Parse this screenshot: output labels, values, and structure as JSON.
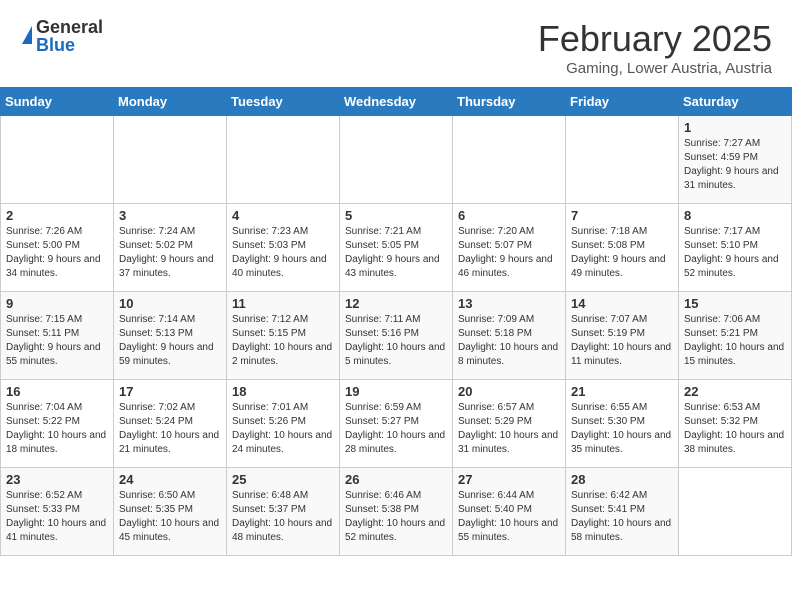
{
  "header": {
    "logo_general": "General",
    "logo_blue": "Blue",
    "month_title": "February 2025",
    "location": "Gaming, Lower Austria, Austria"
  },
  "days_of_week": [
    "Sunday",
    "Monday",
    "Tuesday",
    "Wednesday",
    "Thursday",
    "Friday",
    "Saturday"
  ],
  "weeks": [
    [
      {
        "day": "",
        "info": ""
      },
      {
        "day": "",
        "info": ""
      },
      {
        "day": "",
        "info": ""
      },
      {
        "day": "",
        "info": ""
      },
      {
        "day": "",
        "info": ""
      },
      {
        "day": "",
        "info": ""
      },
      {
        "day": "1",
        "info": "Sunrise: 7:27 AM\nSunset: 4:59 PM\nDaylight: 9 hours and 31 minutes."
      }
    ],
    [
      {
        "day": "2",
        "info": "Sunrise: 7:26 AM\nSunset: 5:00 PM\nDaylight: 9 hours and 34 minutes."
      },
      {
        "day": "3",
        "info": "Sunrise: 7:24 AM\nSunset: 5:02 PM\nDaylight: 9 hours and 37 minutes."
      },
      {
        "day": "4",
        "info": "Sunrise: 7:23 AM\nSunset: 5:03 PM\nDaylight: 9 hours and 40 minutes."
      },
      {
        "day": "5",
        "info": "Sunrise: 7:21 AM\nSunset: 5:05 PM\nDaylight: 9 hours and 43 minutes."
      },
      {
        "day": "6",
        "info": "Sunrise: 7:20 AM\nSunset: 5:07 PM\nDaylight: 9 hours and 46 minutes."
      },
      {
        "day": "7",
        "info": "Sunrise: 7:18 AM\nSunset: 5:08 PM\nDaylight: 9 hours and 49 minutes."
      },
      {
        "day": "8",
        "info": "Sunrise: 7:17 AM\nSunset: 5:10 PM\nDaylight: 9 hours and 52 minutes."
      }
    ],
    [
      {
        "day": "9",
        "info": "Sunrise: 7:15 AM\nSunset: 5:11 PM\nDaylight: 9 hours and 55 minutes."
      },
      {
        "day": "10",
        "info": "Sunrise: 7:14 AM\nSunset: 5:13 PM\nDaylight: 9 hours and 59 minutes."
      },
      {
        "day": "11",
        "info": "Sunrise: 7:12 AM\nSunset: 5:15 PM\nDaylight: 10 hours and 2 minutes."
      },
      {
        "day": "12",
        "info": "Sunrise: 7:11 AM\nSunset: 5:16 PM\nDaylight: 10 hours and 5 minutes."
      },
      {
        "day": "13",
        "info": "Sunrise: 7:09 AM\nSunset: 5:18 PM\nDaylight: 10 hours and 8 minutes."
      },
      {
        "day": "14",
        "info": "Sunrise: 7:07 AM\nSunset: 5:19 PM\nDaylight: 10 hours and 11 minutes."
      },
      {
        "day": "15",
        "info": "Sunrise: 7:06 AM\nSunset: 5:21 PM\nDaylight: 10 hours and 15 minutes."
      }
    ],
    [
      {
        "day": "16",
        "info": "Sunrise: 7:04 AM\nSunset: 5:22 PM\nDaylight: 10 hours and 18 minutes."
      },
      {
        "day": "17",
        "info": "Sunrise: 7:02 AM\nSunset: 5:24 PM\nDaylight: 10 hours and 21 minutes."
      },
      {
        "day": "18",
        "info": "Sunrise: 7:01 AM\nSunset: 5:26 PM\nDaylight: 10 hours and 24 minutes."
      },
      {
        "day": "19",
        "info": "Sunrise: 6:59 AM\nSunset: 5:27 PM\nDaylight: 10 hours and 28 minutes."
      },
      {
        "day": "20",
        "info": "Sunrise: 6:57 AM\nSunset: 5:29 PM\nDaylight: 10 hours and 31 minutes."
      },
      {
        "day": "21",
        "info": "Sunrise: 6:55 AM\nSunset: 5:30 PM\nDaylight: 10 hours and 35 minutes."
      },
      {
        "day": "22",
        "info": "Sunrise: 6:53 AM\nSunset: 5:32 PM\nDaylight: 10 hours and 38 minutes."
      }
    ],
    [
      {
        "day": "23",
        "info": "Sunrise: 6:52 AM\nSunset: 5:33 PM\nDaylight: 10 hours and 41 minutes."
      },
      {
        "day": "24",
        "info": "Sunrise: 6:50 AM\nSunset: 5:35 PM\nDaylight: 10 hours and 45 minutes."
      },
      {
        "day": "25",
        "info": "Sunrise: 6:48 AM\nSunset: 5:37 PM\nDaylight: 10 hours and 48 minutes."
      },
      {
        "day": "26",
        "info": "Sunrise: 6:46 AM\nSunset: 5:38 PM\nDaylight: 10 hours and 52 minutes."
      },
      {
        "day": "27",
        "info": "Sunrise: 6:44 AM\nSunset: 5:40 PM\nDaylight: 10 hours and 55 minutes."
      },
      {
        "day": "28",
        "info": "Sunrise: 6:42 AM\nSunset: 5:41 PM\nDaylight: 10 hours and 58 minutes."
      },
      {
        "day": "",
        "info": ""
      }
    ]
  ]
}
